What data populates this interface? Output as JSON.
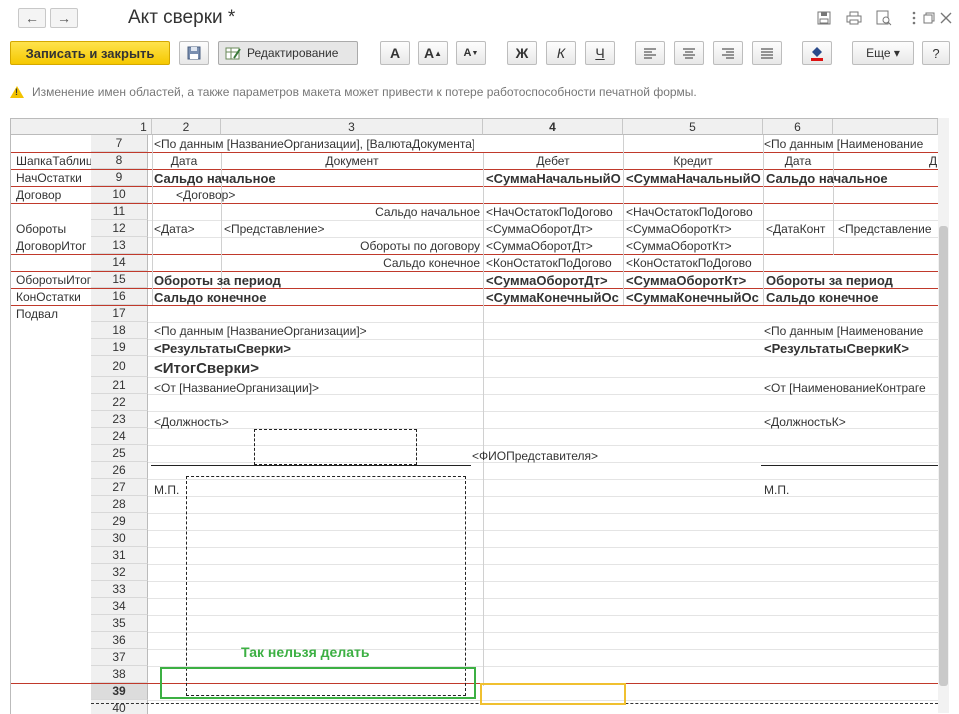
{
  "window": {
    "title": "Акт сверки *",
    "nav": {
      "back": "←",
      "forward": "→"
    },
    "icons": [
      "save-disk-icon",
      "print-icon",
      "preview-icon",
      "more-vertical-icon",
      "restore-icon",
      "close-icon"
    ],
    "icon_glyphs": {
      "save": "🖫",
      "print": "⎙",
      "preview": "🔍",
      "more": "⋮",
      "restore": "⧉",
      "close": "✕"
    }
  },
  "toolbar": {
    "save_close": "Записать и закрыть",
    "save_icon": "🖫",
    "edit": "Редактирование",
    "font_bigger": "A",
    "font_grow": "A",
    "font_shrink": "A",
    "bold": "Ж",
    "italic": "К",
    "underline": "Ч",
    "more": "Еще ▾",
    "help": "?",
    "accent": "#f5c800"
  },
  "warning": "Изменение имен областей, а также параметров макета может привести к потере работоспособности печатной формы.",
  "sheet": {
    "columns": [
      "1",
      "2",
      "3",
      "4",
      "5",
      "6"
    ],
    "rows": [
      "7",
      "8",
      "9",
      "10",
      "11",
      "12",
      "13",
      "14",
      "15",
      "16",
      "17",
      "18",
      "19",
      "20",
      "21",
      "22",
      "23",
      "24",
      "25",
      "26",
      "27",
      "28",
      "29",
      "30",
      "31",
      "32",
      "33",
      "34",
      "35",
      "36",
      "37",
      "38",
      "39",
      "40"
    ],
    "areas": {
      "header": "ШапкаТаблицы",
      "start": "НачОстатки",
      "contract": "Договор",
      "turnovers": "Обороты",
      "contract_total": "ДоговорИтог",
      "turnovers_total": "ОборотыИтог",
      "end": "КонОстатки",
      "footer": "Подвал"
    },
    "cells": {
      "r7a": "<По данным [НазваниеОрганизации],  [ВалютаДокумента]>",
      "r7b": "<По данным [Наименование",
      "r8_date": "Дата",
      "r8_doc": "Документ",
      "r8_debit": "Дебет",
      "r8_credit": "Кредит",
      "r8_date2": "Дата",
      "r8_more": "Д",
      "r9_a": "Сальдо начальное",
      "r9_b": "<СуммаНачальныйО",
      "r9_c": "<СуммаНачальныйО",
      "r9_d": "Сальдо начальное",
      "r10": "<Договор>",
      "r11_a": "Сальдо начальное",
      "r11_b": "<НачОстатокПоДогово",
      "r11_c": "<НачОстатокПоДогово",
      "r12_a": "<Дата>",
      "r12_b": "<Представление>",
      "r12_c": "<СуммаОборотДт>",
      "r12_d": "<СуммаОборотКт>",
      "r12_e": "<ДатаКонт",
      "r12_f": "<Представление",
      "r13_a": "Обороты по договору",
      "r13_b": "<СуммаОборотДт>",
      "r13_c": "<СуммаОборотКт>",
      "r14_a": "Сальдо конечное",
      "r14_b": "<КонОстатокПоДогово",
      "r14_c": "<КонОстатокПоДогово",
      "r15_a": "Обороты за период",
      "r15_b": "<СуммаОборотДт>",
      "r15_c": "<СуммаОборотКт>",
      "r15_d": "Обороты за период",
      "r16_a": "Сальдо конечное",
      "r16_b": "<СуммаКонечныйОс",
      "r16_c": "<СуммаКонечныйОс",
      "r16_d": "Сальдо конечное",
      "r18_a": "<По данным [НазваниеОрганизации]>",
      "r18_b": "<По данным [Наименование",
      "r19_a": "<РезультатыСверки>",
      "r19_b": "<РезультатыСверкиК>",
      "r20": "<ИтогСверки>",
      "r21_a": "<От [НазваниеОрганизации]>",
      "r21_b": "<От [НаименованиеКонтраге",
      "r23_a": "<Должность>",
      "r23_b": "<ДолжностьК>",
      "r25": "<ФИОПредставителя>",
      "r27_a": "М.П.",
      "r27_b": "М.П."
    },
    "annotation": "Так нельзя делать",
    "annotation_color": "#3cb043",
    "selection_color": "#f0c030",
    "line_color": "#c0392b"
  }
}
